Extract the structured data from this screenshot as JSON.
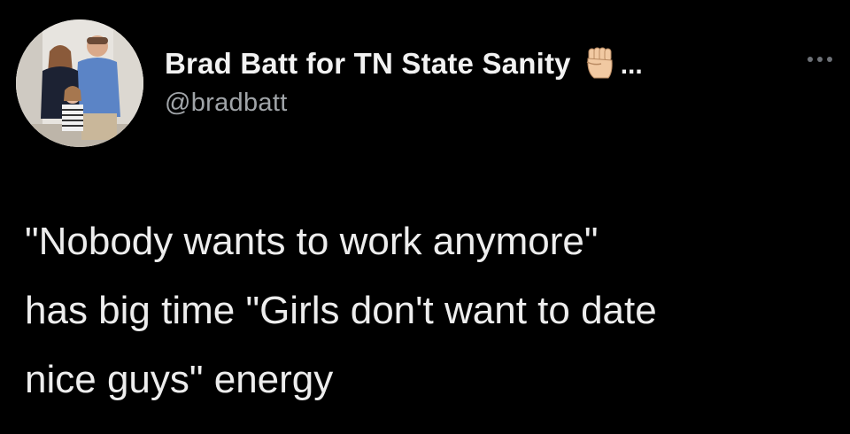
{
  "author": {
    "display_name": "Brad Batt for TN State Sanity",
    "emoji_icon": "raised-fist-icon",
    "truncation": "...",
    "handle": "@bradbatt"
  },
  "menu": {
    "icon": "more-horizontal-icon"
  },
  "tweet": {
    "lines": [
      "\"Nobody wants to work anymore\"",
      "has big time \"Girls don't want to date",
      "nice guys\" energy"
    ]
  },
  "colors": {
    "background": "#000000",
    "primary_text": "#ededed",
    "secondary_text": "#a0a4a8"
  }
}
